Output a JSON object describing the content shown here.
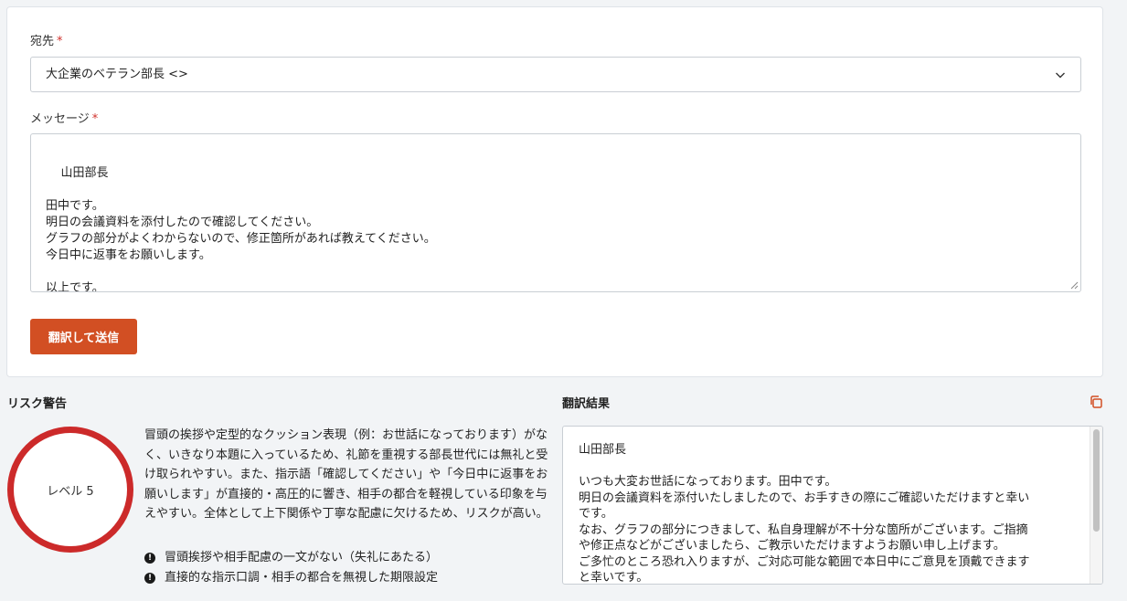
{
  "form": {
    "recipient_label": "宛先",
    "recipient_value": "大企業のベテラン部長 <>",
    "message_label": "メッセージ",
    "required_mark": "*",
    "message_text": "山田部長\n\n田中です。\n明日の会議資料を添付したので確認してください。\nグラフの部分がよくわからないので、修正箇所があれば教えてください。\n今日中に返事をお願いします。\n\n以上です。",
    "send_button_label": "翻訳して送信"
  },
  "risk": {
    "title": "リスク警告",
    "level_label": "レベル 5",
    "description": "冒頭の挨拶や定型的なクッション表現（例：お世話になっております）がなく、いきなり本題に入っているため、礼節を重視する部長世代には無礼と受け取られやすい。また、指示語「確認してください」や「今日中に返事をお願いします」が直接的・高圧的に響き、相手の都合を軽視している印象を与えやすい。全体として上下関係や丁寧な配慮に欠けるため、リスクが高い。",
    "issues": [
      "冒頭挨拶や相手配慮の一文がない（失礼にあたる）",
      "直接的な指示口調・相手の都合を無視した期限設定"
    ],
    "accent_color": "#cc2a2a"
  },
  "translation": {
    "title": "翻訳結果",
    "result_text": "山田部長\n\nいつも大変お世話になっております。田中です。\n明日の会議資料を添付いたしましたので、お手すきの際にご確認いただけますと幸い\nです。\nなお、グラフの部分につきまして、私自身理解が不十分な箇所がございます。ご指摘\nや修正点などがございましたら、ご教示いただけますようお願い申し上げます。\nご多忙のところ恐れ入りますが、ご対応可能な範囲で本日中にご意見を頂戴できます\nと幸いです。"
  },
  "colors": {
    "primary_button": "#d24f23",
    "background": "#f2f4f6",
    "required": "#d0312d"
  }
}
